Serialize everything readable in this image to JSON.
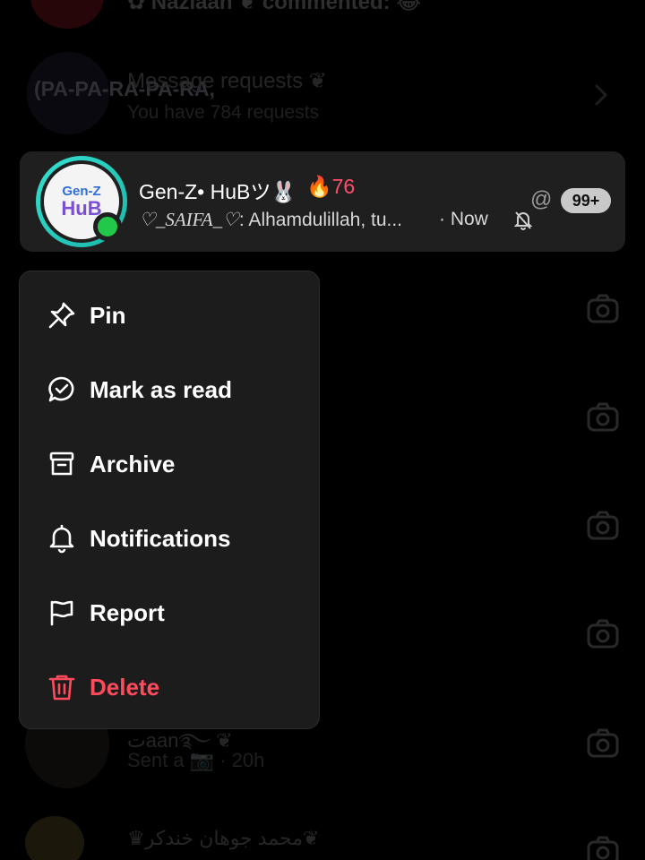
{
  "background": {
    "top_row": {
      "text": "✿ Nazlaan ❦ commented: 😂"
    },
    "message_requests": {
      "title": "Message requests ❦",
      "subtitle": "You have 784 requests",
      "avatar_text": "(PA-PA-RA-PA-RA,"
    },
    "row_bottom_1": {
      "name": "تaan࿐ ❦",
      "subtitle": "Sent a 📷 · 20h"
    },
    "row_bottom_2": {
      "name": "♛محمد جوهان خندكر❦"
    }
  },
  "conversation": {
    "title": "Gen-Z• HuBツ🐰",
    "streak": "🔥76",
    "preview_name": "♡_SAIFA_♡",
    "preview_text": ": Alhamdulillah, tu...",
    "time": "· Now",
    "mention": "@",
    "unread_badge": "99+",
    "avatar_line1": "Gen-Z",
    "avatar_line2": "HuB",
    "online_color": "#21c84a",
    "ring_color": "#2ed3c4"
  },
  "menu": {
    "items": [
      {
        "label": "Pin",
        "icon": "pin-icon"
      },
      {
        "label": "Mark as read",
        "icon": "mark-read-icon"
      },
      {
        "label": "Archive",
        "icon": "archive-icon"
      },
      {
        "label": "Notifications",
        "icon": "bell-icon"
      },
      {
        "label": "Report",
        "icon": "flag-icon"
      },
      {
        "label": "Delete",
        "icon": "trash-icon",
        "color": "#ff4b5c"
      }
    ]
  }
}
